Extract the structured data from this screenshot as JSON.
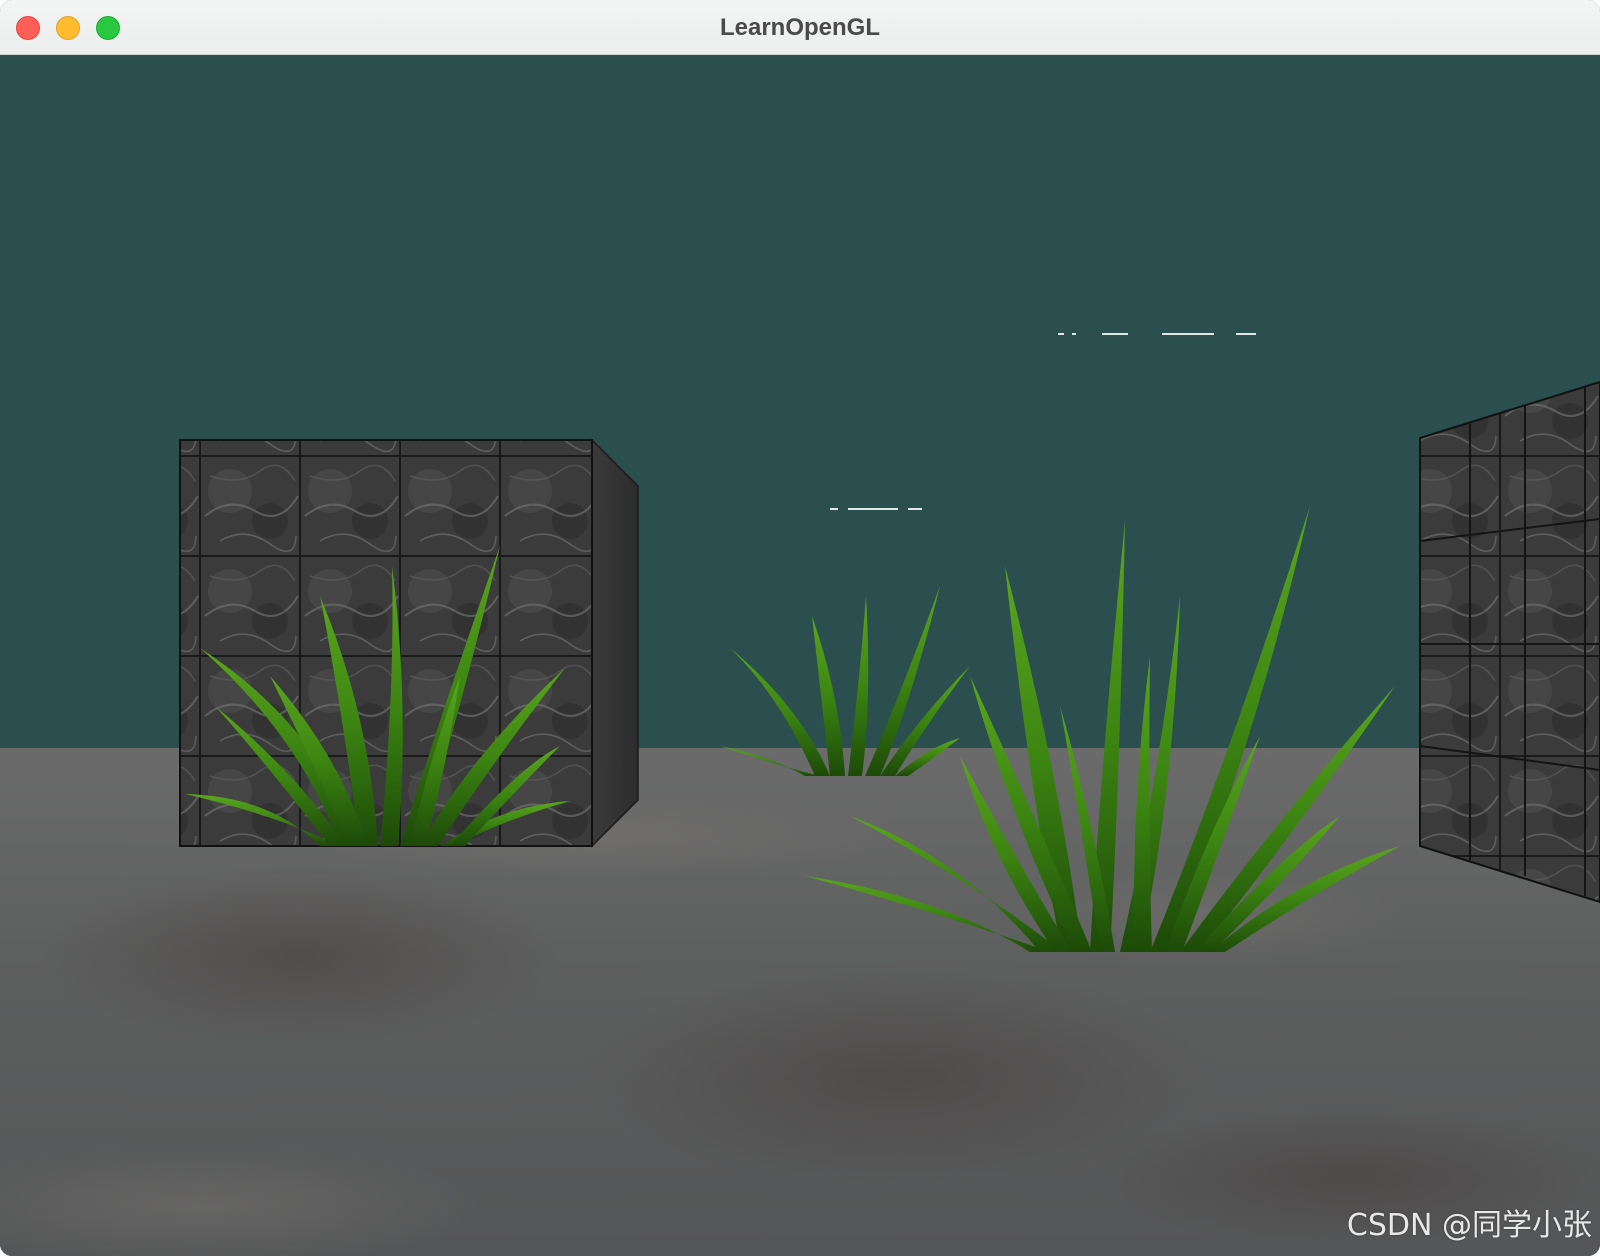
{
  "window": {
    "title": "LearnOpenGL",
    "controls": {
      "close_color": "#ff5f57",
      "minimize_color": "#febc2e",
      "maximize_color": "#28c840"
    }
  },
  "scene": {
    "clear_color": "#2b4f4f",
    "floor_color": "#5a5a5a",
    "cube_color": "#3e3e3e",
    "grass_color": "#3f8a12"
  },
  "watermark": {
    "text": "CSDN @同学小张"
  }
}
